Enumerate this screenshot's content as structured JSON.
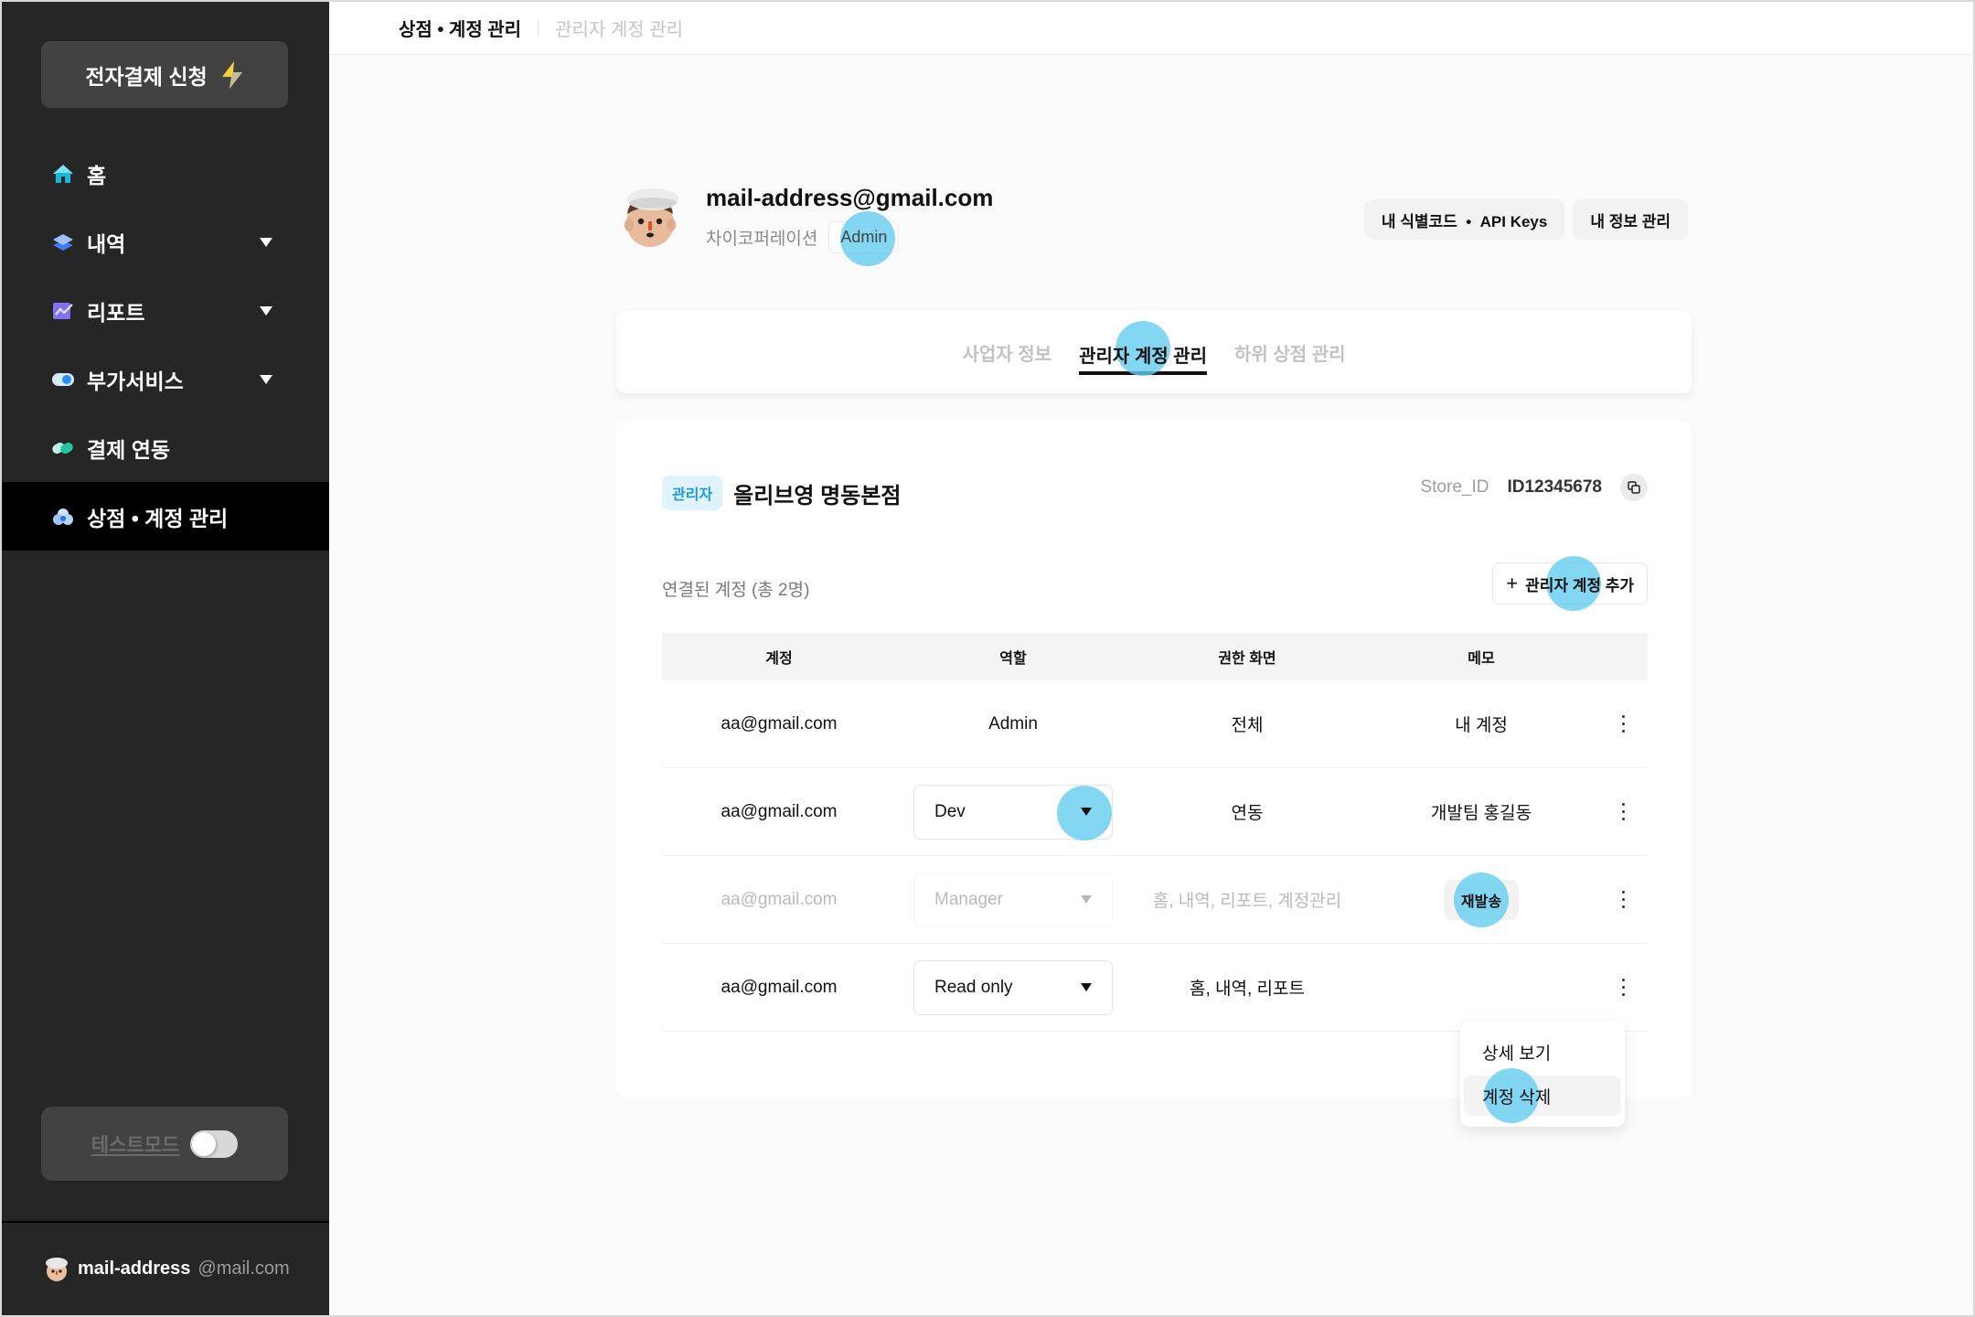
{
  "sidebar": {
    "apply_button": "전자결제 신청",
    "nav": [
      {
        "label": "홈",
        "icon": "home-icon",
        "has_caret": false,
        "active": false
      },
      {
        "label": "내역",
        "icon": "layers-icon",
        "has_caret": true,
        "active": false
      },
      {
        "label": "리포트",
        "icon": "chart-icon",
        "has_caret": true,
        "active": false
      },
      {
        "label": "부가서비스",
        "icon": "toggle-icon",
        "has_caret": true,
        "active": false
      },
      {
        "label": "결제 연동",
        "icon": "link-pill-icon",
        "has_caret": false,
        "active": false
      },
      {
        "label": "상점 • 계정 관리",
        "icon": "store-cloud-icon",
        "has_caret": false,
        "active": true
      }
    ],
    "test_mode": {
      "label": "테스트모드",
      "enabled": false
    },
    "user": {
      "name": "mail-address",
      "domain": "@mail.com"
    }
  },
  "header": {
    "breadcrumb_main": "상점 • 계정 관리",
    "breadcrumb_sub": "관리자 계정 관리"
  },
  "profile": {
    "email": "mail-address@gmail.com",
    "company": "차이코퍼레이션",
    "role": "Admin",
    "actions": [
      "내 식별코드  •  API Keys",
      "내 정보 관리"
    ]
  },
  "tabs": [
    {
      "label": "사업자 정보",
      "active": false
    },
    {
      "label": "관리자 계정 관리",
      "active": true
    },
    {
      "label": "하위 상점 관리",
      "active": false
    }
  ],
  "store": {
    "badge": "관리자",
    "name": "올리브영 명동본점",
    "id_label": "Store_ID",
    "id_value": "ID12345678"
  },
  "accounts": {
    "count_label": "연결된 계정 (총 2명)",
    "add_button": "관리자 계정 추가",
    "columns": [
      "계정",
      "역할",
      "권한 화면",
      "메모"
    ],
    "rows": [
      {
        "email": "aa@gmail.com",
        "role": "Admin",
        "role_editable": false,
        "screens": "전체",
        "memo": "내 계정",
        "pending": false
      },
      {
        "email": "aa@gmail.com",
        "role": "Dev",
        "role_editable": true,
        "screens": "연동",
        "memo": "개발팀 홍길동",
        "pending": false
      },
      {
        "email": "aa@gmail.com",
        "role": "Manager",
        "role_editable": true,
        "screens": "홈, 내역, 리포트, 계정관리",
        "memo_button": "재발송",
        "pending": true
      },
      {
        "email": "aa@gmail.com",
        "role": "Read only",
        "role_editable": true,
        "screens": "홈, 내역, 리포트",
        "memo": "",
        "pending": false
      }
    ]
  },
  "row_menu": {
    "items": [
      "상세 보기",
      "계정 삭제"
    ],
    "hovered": "계정 삭제"
  },
  "colors": {
    "sidebar_bg": "#262626",
    "active_nav_bg": "#000000",
    "badge_bg": "#e0f3fd",
    "badge_text": "#1b9ad6",
    "touch_indicator": "#64cdf0"
  }
}
